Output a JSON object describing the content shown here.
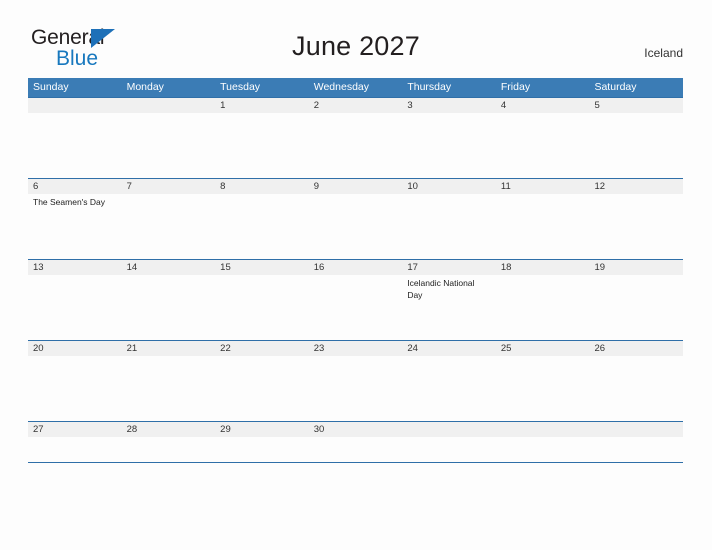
{
  "brand": {
    "name_part1": "General",
    "name_part2": "Blue",
    "triangle_color": "#1d70b8",
    "blue_text_color": "#1878be"
  },
  "header": {
    "title": "June 2027",
    "country": "Iceland"
  },
  "theme": {
    "header_blue": "#3b7cb5",
    "row_line_blue": "#2f6fa8",
    "date_band_gray": "#f0f0f0",
    "page_background": "#fdfdfd"
  },
  "calendar": {
    "day_headers": [
      "Sunday",
      "Monday",
      "Tuesday",
      "Wednesday",
      "Thursday",
      "Friday",
      "Saturday"
    ],
    "weeks": [
      {
        "days": [
          {
            "number": "",
            "event": ""
          },
          {
            "number": "",
            "event": ""
          },
          {
            "number": "1",
            "event": ""
          },
          {
            "number": "2",
            "event": ""
          },
          {
            "number": "3",
            "event": ""
          },
          {
            "number": "4",
            "event": ""
          },
          {
            "number": "5",
            "event": ""
          }
        ]
      },
      {
        "days": [
          {
            "number": "6",
            "event": "The Seamen's Day"
          },
          {
            "number": "7",
            "event": ""
          },
          {
            "number": "8",
            "event": ""
          },
          {
            "number": "9",
            "event": ""
          },
          {
            "number": "10",
            "event": ""
          },
          {
            "number": "11",
            "event": ""
          },
          {
            "number": "12",
            "event": ""
          }
        ]
      },
      {
        "days": [
          {
            "number": "13",
            "event": ""
          },
          {
            "number": "14",
            "event": ""
          },
          {
            "number": "15",
            "event": ""
          },
          {
            "number": "16",
            "event": ""
          },
          {
            "number": "17",
            "event": "Icelandic National Day"
          },
          {
            "number": "18",
            "event": ""
          },
          {
            "number": "19",
            "event": ""
          }
        ]
      },
      {
        "days": [
          {
            "number": "20",
            "event": ""
          },
          {
            "number": "21",
            "event": ""
          },
          {
            "number": "22",
            "event": ""
          },
          {
            "number": "23",
            "event": ""
          },
          {
            "number": "24",
            "event": ""
          },
          {
            "number": "25",
            "event": ""
          },
          {
            "number": "26",
            "event": ""
          }
        ]
      },
      {
        "days": [
          {
            "number": "27",
            "event": ""
          },
          {
            "number": "28",
            "event": ""
          },
          {
            "number": "29",
            "event": ""
          },
          {
            "number": "30",
            "event": ""
          },
          {
            "number": "",
            "event": ""
          },
          {
            "number": "",
            "event": ""
          },
          {
            "number": "",
            "event": ""
          }
        ]
      }
    ]
  }
}
